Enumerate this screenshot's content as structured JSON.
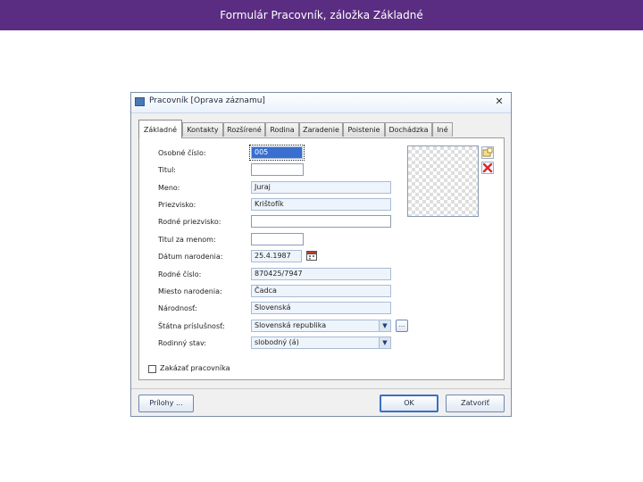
{
  "slide": {
    "title": "Formulár Pracovník, záložka Základné"
  },
  "window": {
    "title": "Pracovník   [Oprava záznamu]",
    "close_glyph": "✕"
  },
  "tabs": [
    {
      "label": "Základné",
      "active": true
    },
    {
      "label": "Kontakty"
    },
    {
      "label": "Rozšírené"
    },
    {
      "label": "Rodina"
    },
    {
      "label": "Zaradenie"
    },
    {
      "label": "Poistenie"
    },
    {
      "label": "Dochádzka"
    },
    {
      "label": "Iné"
    }
  ],
  "form": {
    "osobne_cislo": {
      "label": "Osobné číslo:",
      "value": "005"
    },
    "titul": {
      "label": "Titul:",
      "value": ""
    },
    "meno": {
      "label": "Meno:",
      "value": "Juraj"
    },
    "priezvisko": {
      "label": "Priezvisko:",
      "value": "Krištofík"
    },
    "rodne_priezvisko": {
      "label": "Rodné priezvisko:",
      "value": ""
    },
    "titul_za_menom": {
      "label": "Titul za menom:",
      "value": ""
    },
    "datum_narodenia": {
      "label": "Dátum narodenia:",
      "value": "25.4.1987"
    },
    "rodne_cislo": {
      "label": "Rodné číslo:",
      "value": "870425/7947"
    },
    "miesto_narodenia": {
      "label": "Miesto narodenia:",
      "value": "Čadca"
    },
    "narodnost": {
      "label": "Národnosť:",
      "value": "Slovenská"
    },
    "statna_prislusnost": {
      "label": "Štátna príslušnosť:",
      "value": "Slovenská republika"
    },
    "rodinny_stav": {
      "label": "Rodinný stav:",
      "value": "slobodný (á)"
    },
    "zakazat": {
      "label": "Zakázať pracovníka",
      "checked": false
    }
  },
  "buttons": {
    "prilohy": "Prílohy ...",
    "ok": "OK",
    "zatvorit": "Zatvoriť",
    "ellipsis": "..."
  },
  "icons": {
    "calendar": "calendar-icon",
    "add_photo": "add-photo-icon",
    "delete_photo": "delete-photo-icon"
  },
  "colors": {
    "header_bg": "#5a2d82",
    "focus_bg": "#3a6fd0"
  }
}
